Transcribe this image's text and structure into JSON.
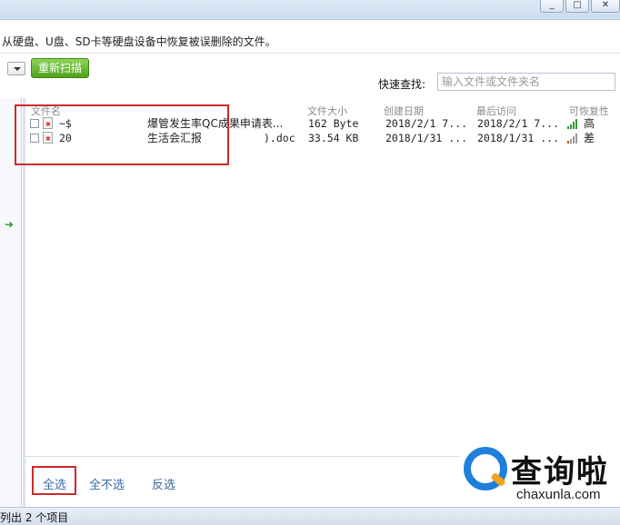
{
  "window": {
    "min": "_",
    "max": "□",
    "close": "✕"
  },
  "description": "从硬盘、U盘、SD卡等硬盘设备中恢复被误删除的文件。",
  "toolbar": {
    "rescan_label": "重新扫描",
    "quick_find_label": "快速查找:",
    "quick_find_placeholder": "输入文件或文件夹名"
  },
  "columns": {
    "name": "文件名",
    "size": "文件大小",
    "created": "创建日期",
    "accessed": "最后访问",
    "recoverability": "可恢复性"
  },
  "files": [
    {
      "name_prefix": "~$",
      "name_visible": "爆管发生率QC成果申请表...",
      "size": "162 Byte",
      "created": "2018/2/1 7...",
      "accessed": "2018/2/1 7...",
      "recoverability": "高",
      "signal_color": "#2f9a2f"
    },
    {
      "name_prefix": "20",
      "name_visible": "生活会汇报",
      "name_suffix": ").doc",
      "size": "33.54 KB",
      "created": "2018/1/31 ...",
      "accessed": "2018/1/31 ...",
      "recoverability": "差",
      "signal_color": "#9a9a9a"
    }
  ],
  "selection": {
    "select_all": "全选",
    "select_none": "全不选",
    "invert": "反选"
  },
  "watermark": {
    "brand": "查询啦",
    "domain": "chaxunla.com"
  },
  "status": "列出 2 个项目",
  "icons": {
    "left_arrow": "➜"
  }
}
